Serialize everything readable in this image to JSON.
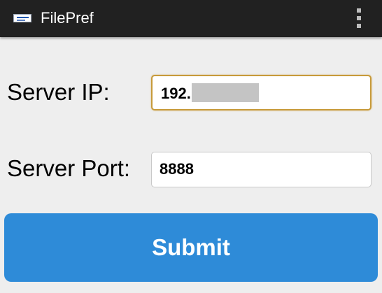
{
  "action_bar": {
    "title": "FilePref",
    "app_icon": "app-logo-icon",
    "overflow_icon": "more-vert-icon",
    "background_color": "#212121"
  },
  "form": {
    "server_ip": {
      "label": "Server IP:",
      "value": "192.",
      "value_redacted": true
    },
    "server_port": {
      "label": "Server Port:",
      "value": "8888"
    },
    "focus_color": "#c79a3a"
  },
  "submit": {
    "label": "Submit",
    "color": "#2e8bd8"
  }
}
